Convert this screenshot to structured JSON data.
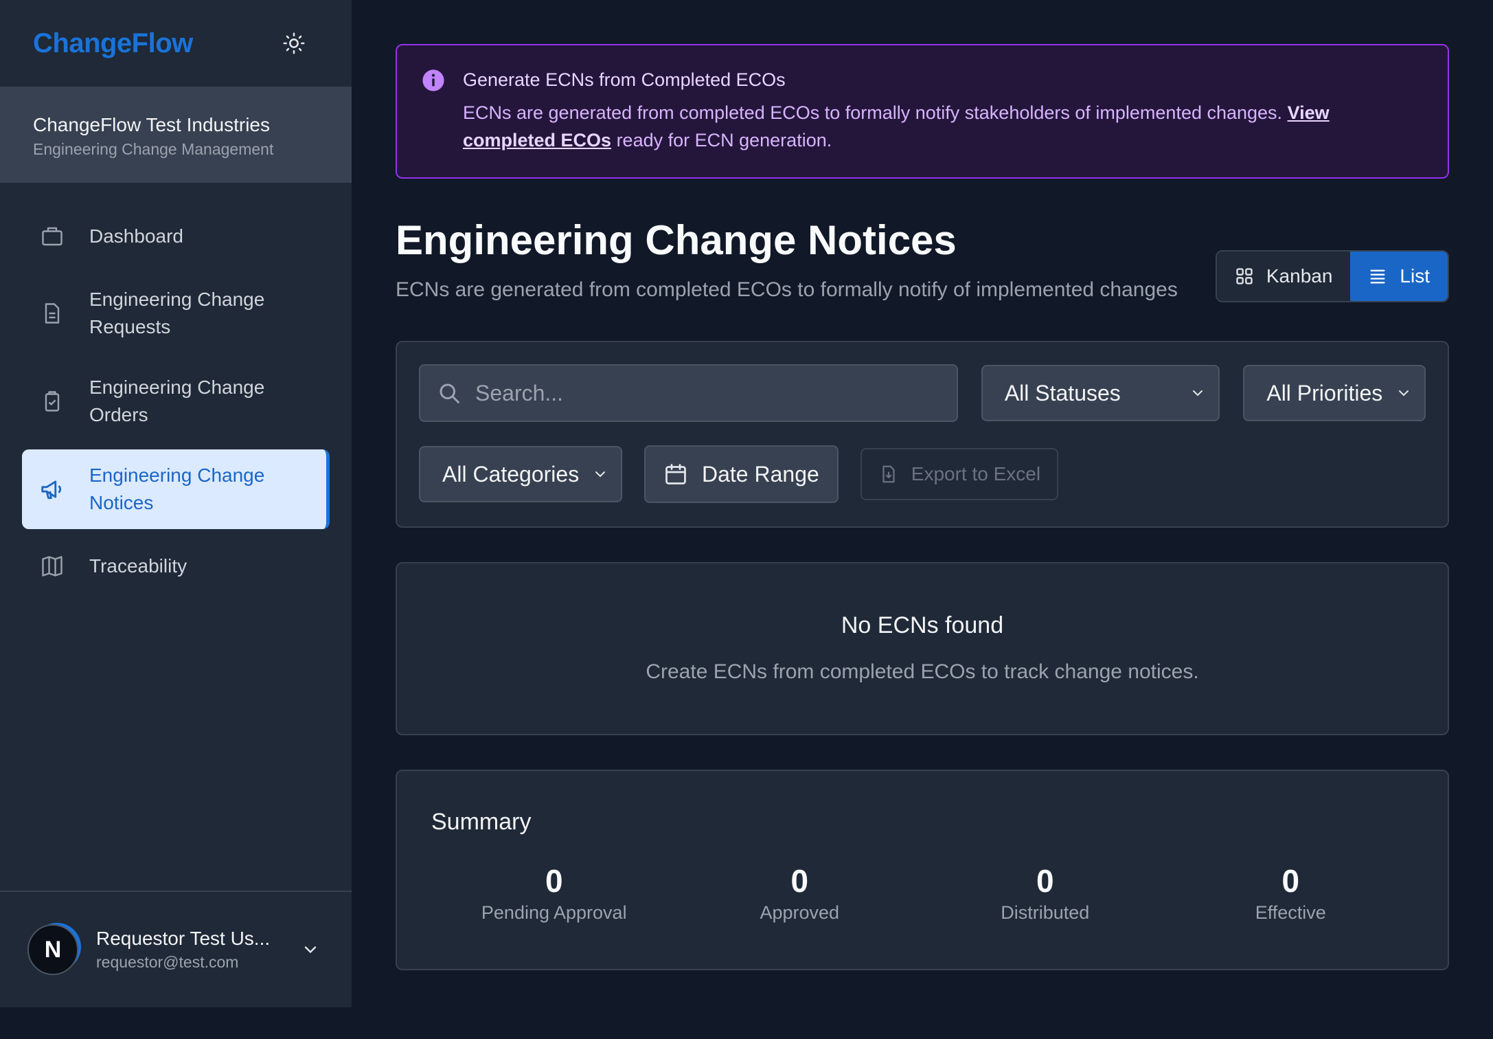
{
  "app": {
    "brand": "ChangeFlow"
  },
  "org": {
    "name": "ChangeFlow Test Industries",
    "subtitle": "Engineering Change Management"
  },
  "sidebar": {
    "items": [
      {
        "label": "Dashboard",
        "icon": "briefcase-icon"
      },
      {
        "label": "Engineering Change Requests",
        "icon": "document-icon"
      },
      {
        "label": "Engineering Change Orders",
        "icon": "clipboard-check-icon"
      },
      {
        "label": "Engineering Change Notices",
        "icon": "megaphone-icon",
        "active": true
      },
      {
        "label": "Traceability",
        "icon": "map-icon"
      }
    ]
  },
  "user": {
    "initial": "N",
    "name": "Requestor Test Us...",
    "email": "requestor@test.com"
  },
  "banner": {
    "title": "Generate ECNs from Completed ECOs",
    "body": "ECNs are generated from completed ECOs to formally notify stakeholders of implemented changes. ",
    "link": "View completed ECOs",
    "tail": " ready for ECN generation."
  },
  "page": {
    "title": "Engineering Change Notices",
    "subtitle": "ECNs are generated from completed ECOs to formally notify of implemented changes"
  },
  "view_toggle": {
    "kanban": "Kanban",
    "list": "List",
    "active": "list"
  },
  "filters": {
    "search_placeholder": "Search...",
    "status": "All Statuses",
    "priority": "All Priorities",
    "category": "All Categories",
    "date_range": "Date Range",
    "export": "Export to Excel"
  },
  "empty_state": {
    "title": "No ECNs found",
    "message": "Create ECNs from completed ECOs to track change notices."
  },
  "summary": {
    "title": "Summary",
    "stats": [
      {
        "value": "0",
        "label": "Pending Approval"
      },
      {
        "value": "0",
        "label": "Approved"
      },
      {
        "value": "0",
        "label": "Distributed"
      },
      {
        "value": "0",
        "label": "Effective"
      }
    ]
  },
  "colors": {
    "accent": "#1a73d9",
    "banner_border": "#9333ea",
    "background": "#111827",
    "sidebar": "#1f2937"
  }
}
